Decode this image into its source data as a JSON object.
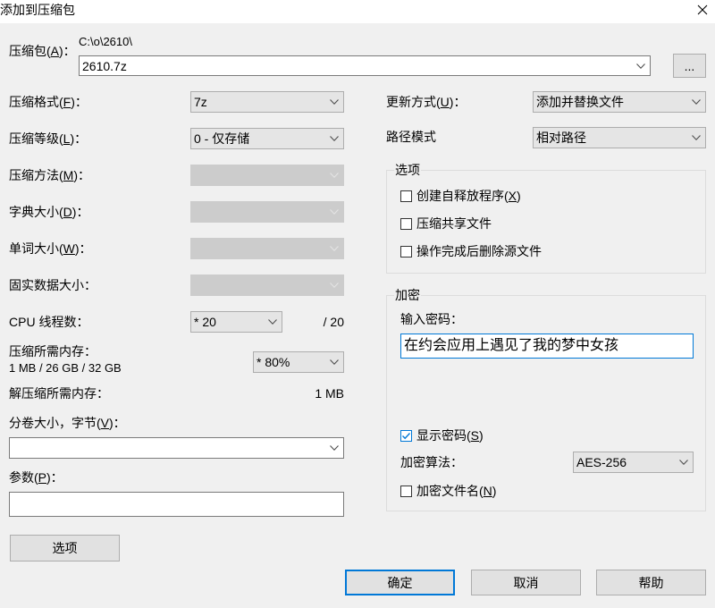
{
  "window": {
    "title": "添加到压缩包"
  },
  "icons": {
    "close": "close-icon",
    "dropdown": "chevron-down-icon",
    "check": "checkmark-icon"
  },
  "colors": {
    "window_bg": "#f0f0f0",
    "title_bg": "#ffffff",
    "accent": "#0078d7",
    "disabled_field": "#cccccc"
  },
  "archive": {
    "label": "压缩包(A)：",
    "folder": "C:\\o\\2610\\",
    "name": "2610.7z",
    "browse_button": "..."
  },
  "compression": {
    "format": {
      "label": "压缩格式(F)：",
      "value": "7z"
    },
    "level": {
      "label": "压缩等级(L)：",
      "value": "0 - 仅存储"
    },
    "method": {
      "label": "压缩方法(M)：",
      "enabled": false
    },
    "dictionary_size": {
      "label": "字典大小(D)：",
      "enabled": false
    },
    "word_size": {
      "label": "单词大小(W)：",
      "enabled": false
    },
    "solid_block_size": {
      "label": "固实数据大小：",
      "enabled": false
    },
    "cpu_threads": {
      "label": "CPU 线程数：",
      "value": "* 20",
      "max": "/ 20"
    },
    "memory_usage": {
      "label": "压缩所需内存：",
      "detail": "1 MB / 26 GB / 32 GB",
      "value": "* 80%"
    },
    "decompress_memory": {
      "label": "解压缩所需内存：",
      "value": "1 MB"
    },
    "split_volume": {
      "label": "分卷大小，字节(V)："
    },
    "parameters": {
      "label": "参数(P)："
    },
    "options_button": "选项"
  },
  "update": {
    "mode": {
      "label": "更新方式(U)：",
      "value": "添加并替换文件"
    },
    "path_mode": {
      "label": "路径模式",
      "value": "相对路径"
    }
  },
  "options": {
    "title": "选项",
    "items": [
      {
        "label": "创建自释放程序(X)",
        "checked": false
      },
      {
        "label": "压缩共享文件",
        "checked": false
      },
      {
        "label": "操作完成后删除源文件",
        "checked": false
      }
    ]
  },
  "encryption": {
    "title": "加密",
    "password_label": "输入密码：",
    "password": "在约会应用上遇见了我的梦中女孩",
    "show_password": {
      "label": "显示密码(S)",
      "checked": true
    },
    "method_label": "加密算法：",
    "method": "AES-256",
    "encrypt_file_names": {
      "label": "加密文件名(N)",
      "checked": false
    }
  },
  "buttons": {
    "ok": "确定",
    "cancel": "取消",
    "help": "帮助"
  }
}
